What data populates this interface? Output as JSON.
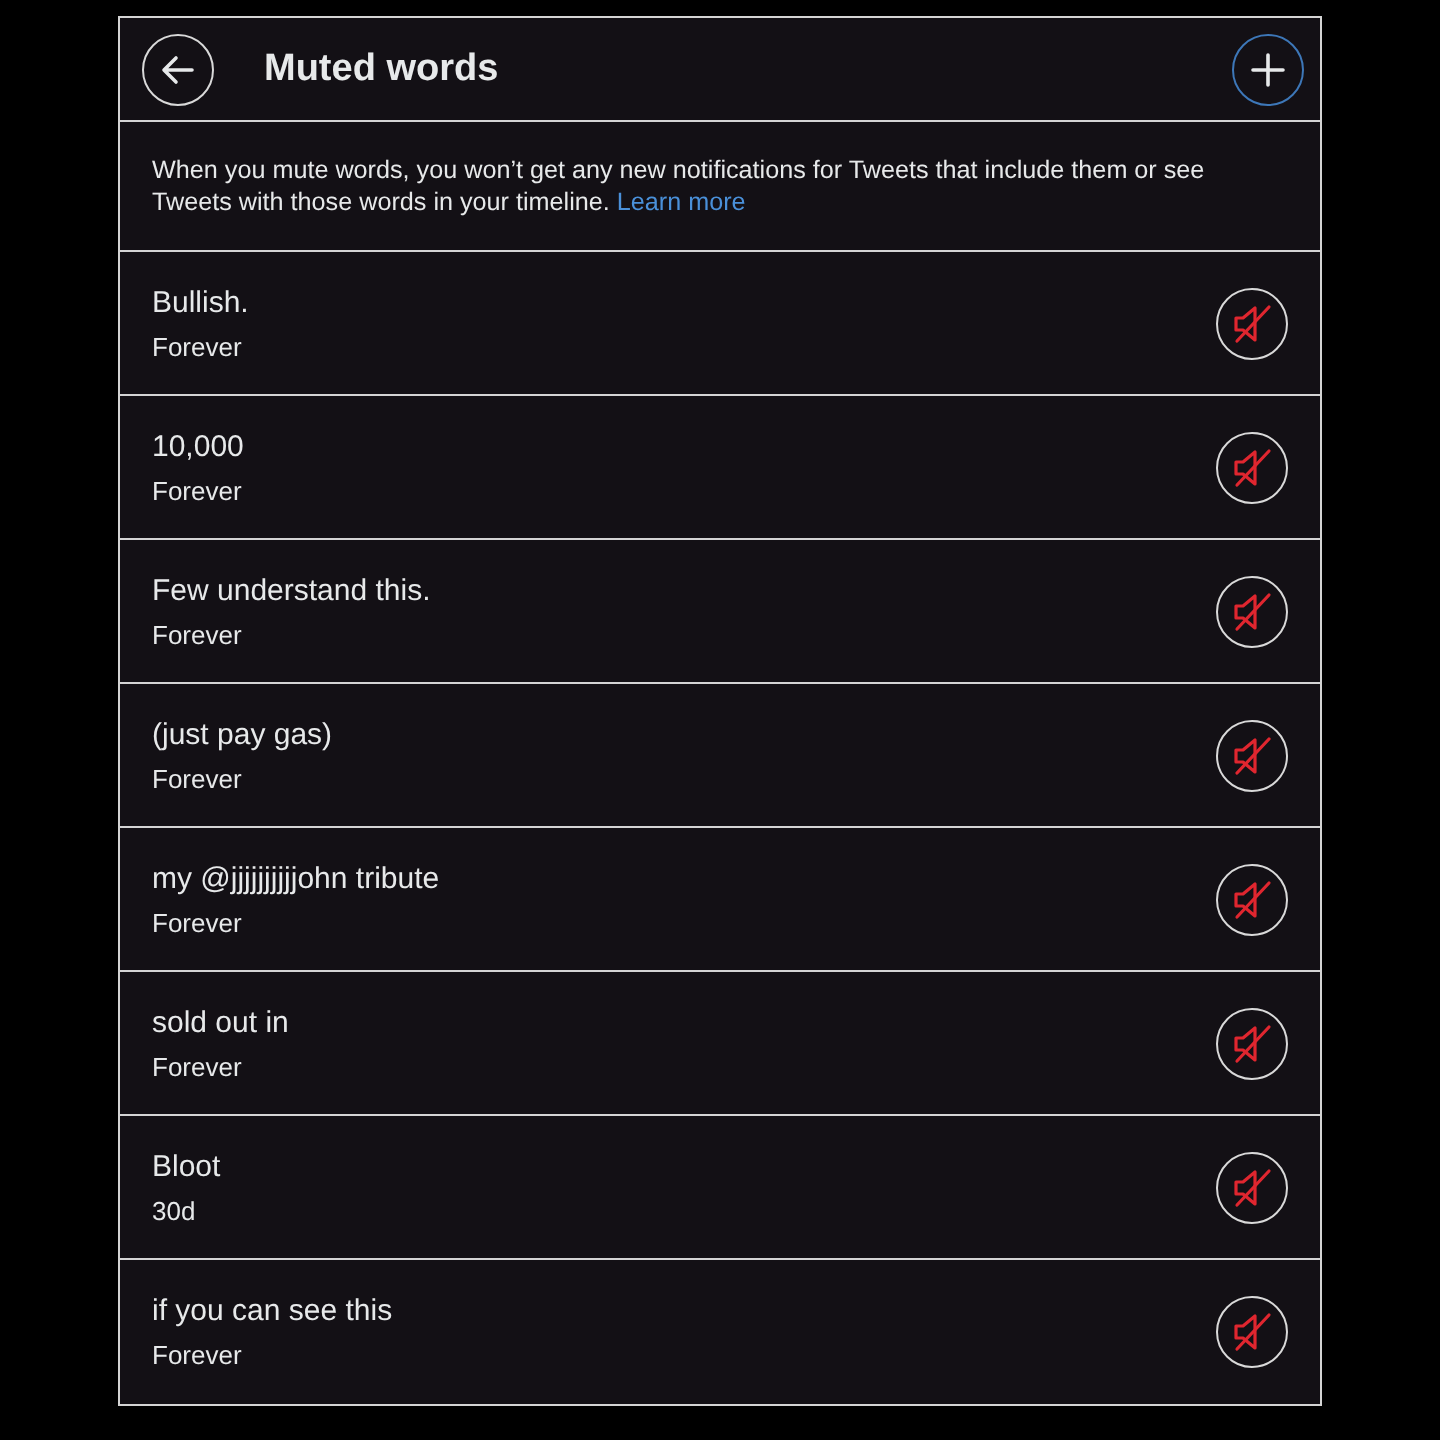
{
  "header": {
    "title": "Muted words",
    "add_button": {
      "focused": true
    }
  },
  "description": {
    "text": "When you mute words, you won’t get any new notifications for Tweets that include them or see Tweets with those words in your timeline.",
    "link": "Learn more"
  },
  "muted_words": [
    {
      "word": "Bullish.",
      "duration": "Forever"
    },
    {
      "word": "10,000",
      "duration": "Forever"
    },
    {
      "word": "Few understand this.",
      "duration": "Forever"
    },
    {
      "word": "(just pay gas)",
      "duration": "Forever"
    },
    {
      "word": "my @jjjjjjjjjjohn tribute",
      "duration": "Forever"
    },
    {
      "word": "sold out in",
      "duration": "Forever"
    },
    {
      "word": "Bloot",
      "duration": "30d"
    },
    {
      "word": "if you can see this",
      "duration": "Forever"
    }
  ]
}
